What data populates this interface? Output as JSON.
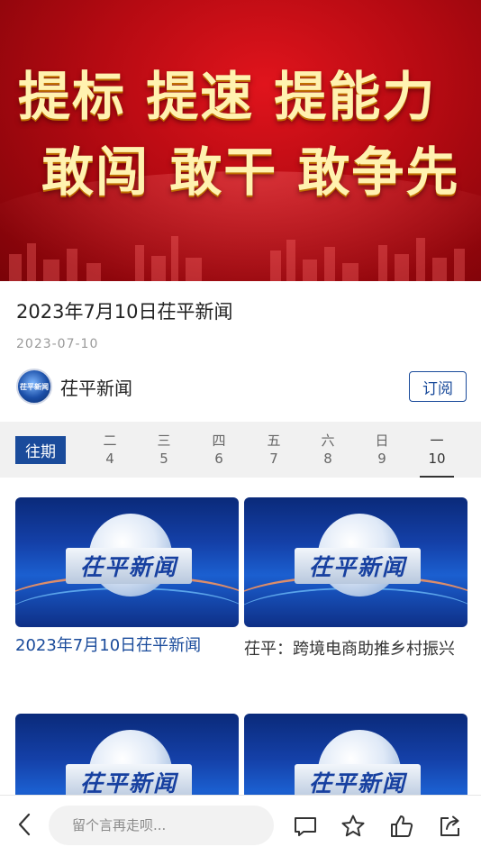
{
  "banner": {
    "line1": "提标 提速 提能力",
    "line2": "敢闯 敢干 敢争先"
  },
  "article": {
    "title": "2023年7月10日茌平新闻",
    "date": "2023-07-10"
  },
  "channel": {
    "name": "茌平新闻",
    "avatar_text": "茌平新闻",
    "subscribe_label": "订阅"
  },
  "date_strip": {
    "past_label": "往期",
    "days": [
      {
        "weekday": "二",
        "date": "4"
      },
      {
        "weekday": "三",
        "date": "5"
      },
      {
        "weekday": "四",
        "date": "6"
      },
      {
        "weekday": "五",
        "date": "7"
      },
      {
        "weekday": "六",
        "date": "8"
      },
      {
        "weekday": "日",
        "date": "9"
      },
      {
        "weekday": "一",
        "date": "10"
      }
    ],
    "active_index": 6
  },
  "cards": [
    {
      "thumb_text": "茌平新闻",
      "title": "2023年7月10日茌平新闻"
    },
    {
      "thumb_text": "茌平新闻",
      "title": "茌平：跨境电商助推乡村振兴"
    },
    {
      "thumb_text": "茌平新闻",
      "title": ""
    },
    {
      "thumb_text": "茌平新闻",
      "title": ""
    }
  ],
  "bottom_bar": {
    "comment_placeholder": "留个言再走呗...",
    "icons": [
      "back-icon",
      "comment-icon",
      "star-icon",
      "like-icon",
      "share-icon"
    ]
  },
  "colors": {
    "accent_blue": "#1a4b9b",
    "banner_red": "#c8101a",
    "banner_text": "#fff2b0"
  }
}
